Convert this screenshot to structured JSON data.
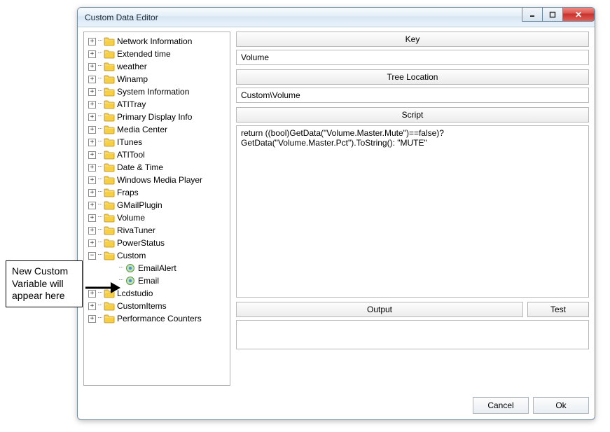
{
  "annotation": {
    "text": "New Custom Variable will appear here"
  },
  "window": {
    "title": "Custom Data Editor"
  },
  "tree": {
    "items": [
      {
        "label": "Network Information",
        "expander": "+"
      },
      {
        "label": "Extended time",
        "expander": "+"
      },
      {
        "label": "weather",
        "expander": "+"
      },
      {
        "label": "Winamp",
        "expander": "+"
      },
      {
        "label": "System Information",
        "expander": "+"
      },
      {
        "label": "ATITray",
        "expander": "+"
      },
      {
        "label": "Primary Display Info",
        "expander": "+"
      },
      {
        "label": "Media Center",
        "expander": "+"
      },
      {
        "label": "ITunes",
        "expander": "+"
      },
      {
        "label": "ATITool",
        "expander": "+"
      },
      {
        "label": "Date & Time",
        "expander": "+"
      },
      {
        "label": "Windows Media Player",
        "expander": "+"
      },
      {
        "label": "Fraps",
        "expander": "+"
      },
      {
        "label": "GMailPlugin",
        "expander": "+"
      },
      {
        "label": "Volume",
        "expander": "+"
      },
      {
        "label": "RivaTuner",
        "expander": "+"
      },
      {
        "label": "PowerStatus",
        "expander": "+"
      },
      {
        "label": "Custom",
        "expander": "−"
      },
      {
        "label": "Lcdstudio",
        "expander": "+"
      },
      {
        "label": "CustomItems",
        "expander": "+"
      },
      {
        "label": "Performance Counters",
        "expander": "+"
      }
    ],
    "custom_children": [
      {
        "label": "EmailAlert"
      },
      {
        "label": "Email"
      }
    ]
  },
  "panel": {
    "key_header": "Key",
    "key_value": "Volume",
    "tree_loc_header": "Tree Location",
    "tree_loc_value": "Custom\\Volume",
    "script_header": "Script",
    "script_text": "return ((bool)GetData(\"Volume.Master.Mute\")==false)?\nGetData(\"Volume.Master.Pct\").ToString(): \"MUTE\"",
    "output_header": "Output",
    "test_button": "Test"
  },
  "buttons": {
    "cancel": "Cancel",
    "ok": "Ok"
  }
}
